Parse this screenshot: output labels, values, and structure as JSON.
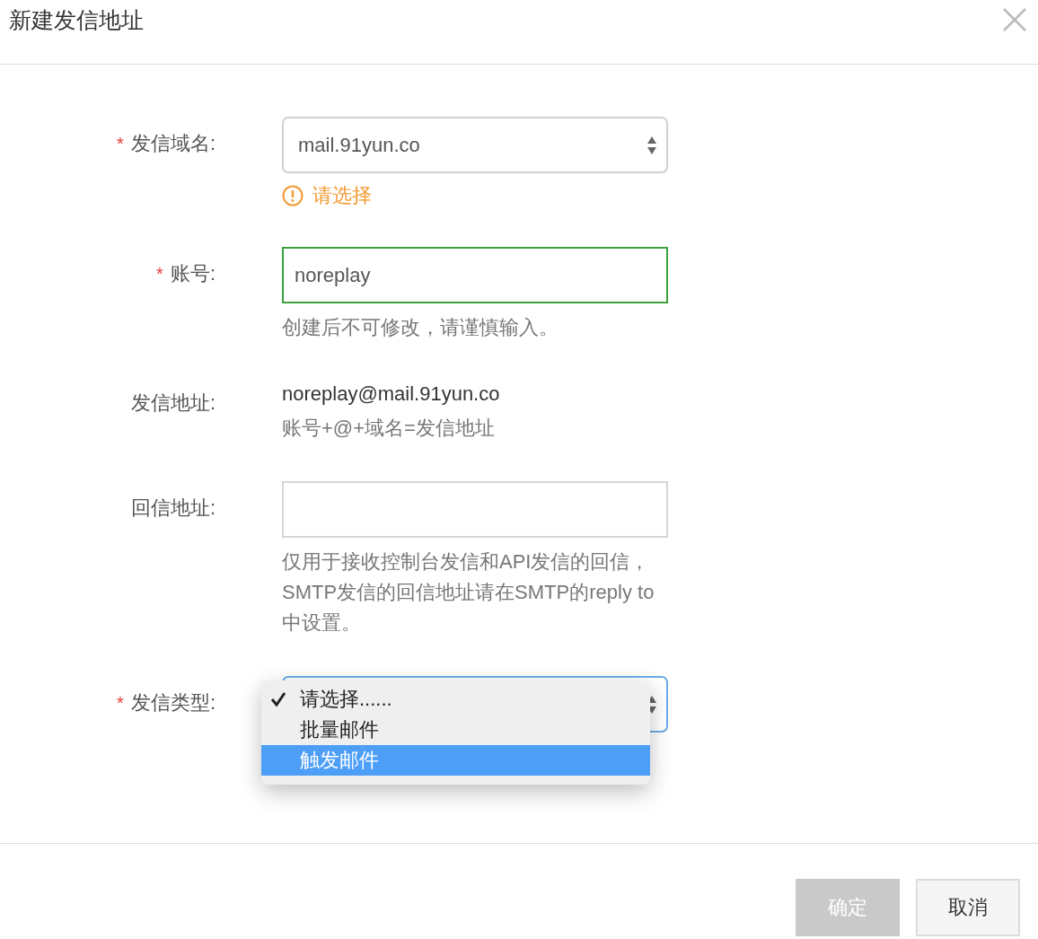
{
  "dialog": {
    "title": "新建发信地址"
  },
  "fields": [
    {
      "kind": "select",
      "label": "发信域名:",
      "required_mark": "*",
      "value": "mail.91yun.co",
      "error": "请选择"
    },
    {
      "kind": "input",
      "label": "账号:",
      "required_mark": "*",
      "value": "noreplay",
      "valid": true,
      "hint": "创建后不可修改，请谨慎输入。"
    },
    {
      "kind": "text",
      "label": "发信地址:",
      "value": "noreplay@mail.91yun.co",
      "hint": "账号+@+域名=发信地址"
    },
    {
      "kind": "input",
      "label": "回信地址:",
      "valid": false,
      "hint": "仅用于接收控制台发信和API发信的回信，SMTP发信的回信地址请在SMTP的reply to中设置。"
    },
    {
      "kind": "select",
      "label": "发信类型:",
      "required_mark": "*",
      "focused": true,
      "open": true,
      "options": [
        {
          "label": "请选择......",
          "checked": true,
          "highlighted": false
        },
        {
          "label": "批量邮件",
          "checked": false,
          "highlighted": false
        },
        {
          "label": "触发邮件",
          "checked": false,
          "highlighted": true
        }
      ]
    }
  ],
  "buttons": [
    {
      "label": "确定",
      "disabled": true
    },
    {
      "label": "取消",
      "disabled": false
    }
  ]
}
